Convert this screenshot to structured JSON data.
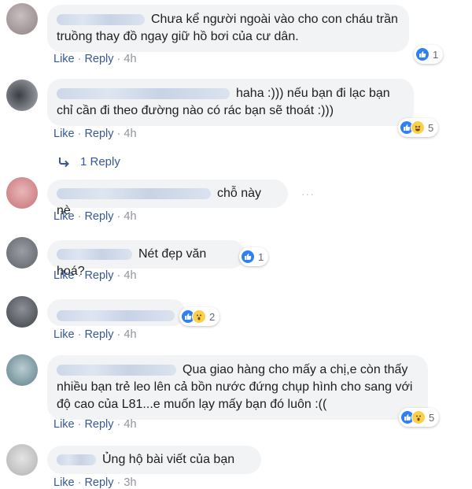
{
  "labels": {
    "like": "Like",
    "reply": "Reply"
  },
  "comments": [
    {
      "text": "Chưa kể người ngoài vào cho con cháu trần truồng thay đồ ngay giữ hồ bơi của cư dân.",
      "time": "4h",
      "reaction_count": "1",
      "reactions": [
        "like"
      ],
      "avatar_color": "#a79a9c"
    },
    {
      "text": "haha :))) nếu bạn đi lạc bạn chỉ cần đi theo đường nào có rác bạn sẽ thoát :)))",
      "time": "4h",
      "reaction_count": "5",
      "reactions": [
        "like",
        "haha"
      ],
      "avatar_color": "#6b6f75",
      "replies": "1 Reply"
    },
    {
      "text": "chỗ này nè",
      "time": "4h",
      "avatar_color": "#d98c90"
    },
    {
      "text": "Nét đẹp văn hoá?",
      "time": "4h",
      "reaction_count": "1",
      "reactions": [
        "like"
      ],
      "avatar_color": "#7b7f86"
    },
    {
      "text": "",
      "time": "4h",
      "reaction_count": "2",
      "reactions": [
        "like",
        "wow"
      ],
      "avatar_color": "#5c6066"
    },
    {
      "text": "Qua giao hàng cho mấy a chị,e còn thấy nhiều bạn trẻ leo lên cả bồn nước đứng chụp hình cho sang với độ cao của L81...e muốn lạy mấy bạn đó luôn :((",
      "time": "4h",
      "reaction_count": "5",
      "reactions": [
        "like",
        "wow"
      ],
      "avatar_color": "#7f9aa3"
    },
    {
      "text": "Ủng hộ bài viết của bạn",
      "time": "3h",
      "avatar_color": "#c8c8c8"
    }
  ]
}
